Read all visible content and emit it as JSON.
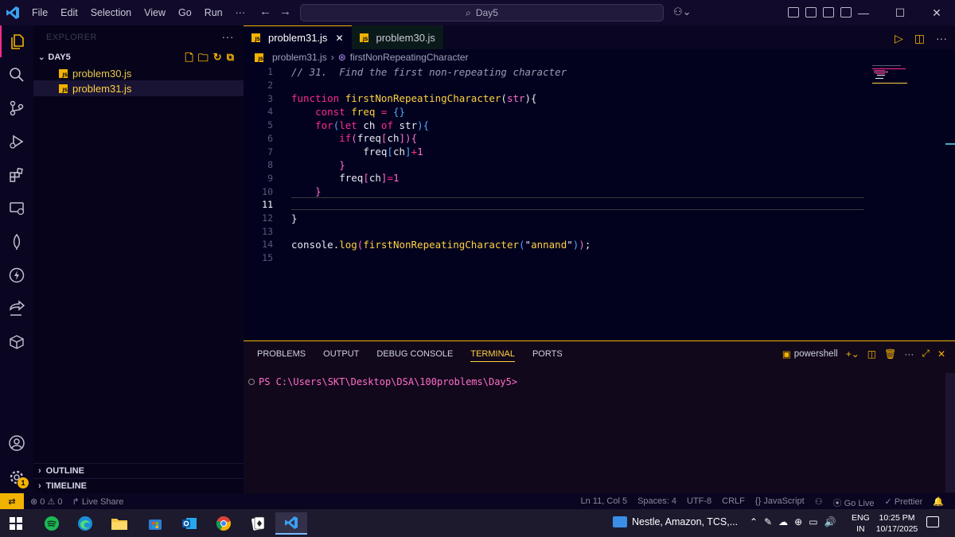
{
  "titlebar": {
    "menu": [
      "File",
      "Edit",
      "Selection",
      "View",
      "Go",
      "Run",
      "···"
    ],
    "search": "Day5",
    "controls": {
      "minimize": "—",
      "maximize": "☐",
      "close": "✕"
    }
  },
  "sidebar": {
    "explorer_title": "EXPLORER",
    "more": "···",
    "folder": "DAY5",
    "files": [
      {
        "name": "problem30.js"
      },
      {
        "name": "problem31.js",
        "selected": true
      }
    ],
    "outline": "OUTLINE",
    "timeline": "TIMELINE"
  },
  "tabs": [
    {
      "label": "problem31.js",
      "active": true,
      "close": "✕"
    },
    {
      "label": "problem30.js",
      "active": false
    }
  ],
  "breadcrumb": {
    "file": "problem31.js",
    "symbol": "firstNonRepeatingCharacter"
  },
  "editor": {
    "current_line": 11,
    "lines": [
      "// 31.  Find the first non-repeating character",
      "",
      "function firstNonRepeatingCharacter(str){",
      "    const freq = {}",
      "    for(let ch of str){",
      "        if(freq[ch]){",
      "            freq[ch]+1",
      "        }",
      "        freq[ch]=1",
      "    }",
      "",
      "}",
      "",
      "console.log(firstNonRepeatingCharacter(\"annand\"));",
      ""
    ]
  },
  "panel": {
    "tabs": [
      "PROBLEMS",
      "OUTPUT",
      "DEBUG CONSOLE",
      "TERMINAL",
      "PORTS"
    ],
    "active_tab": "TERMINAL",
    "shell": "powershell",
    "prompt": "PS C:\\Users\\SKT\\Desktop\\DSA\\100problems\\Day5>"
  },
  "statusbar": {
    "errors": "0",
    "warnings": "0",
    "live_share": "Live Share",
    "position": "Ln 11, Col 5",
    "spaces": "Spaces: 4",
    "encoding": "UTF-8",
    "eol": "CRLF",
    "language": "JavaScript",
    "go_live": "Go Live",
    "prettier": "Prettier"
  },
  "activity": {
    "badge": "1"
  },
  "taskbar": {
    "news": "Nestle, Amazon, TCS,...",
    "lang_top": "ENG",
    "lang_bottom": "IN",
    "time": "10:25 PM",
    "date": "10/17/2025"
  },
  "colors": {
    "accent": "#f2b200",
    "keyword": "#ff2a8a",
    "background": "#02021f"
  }
}
